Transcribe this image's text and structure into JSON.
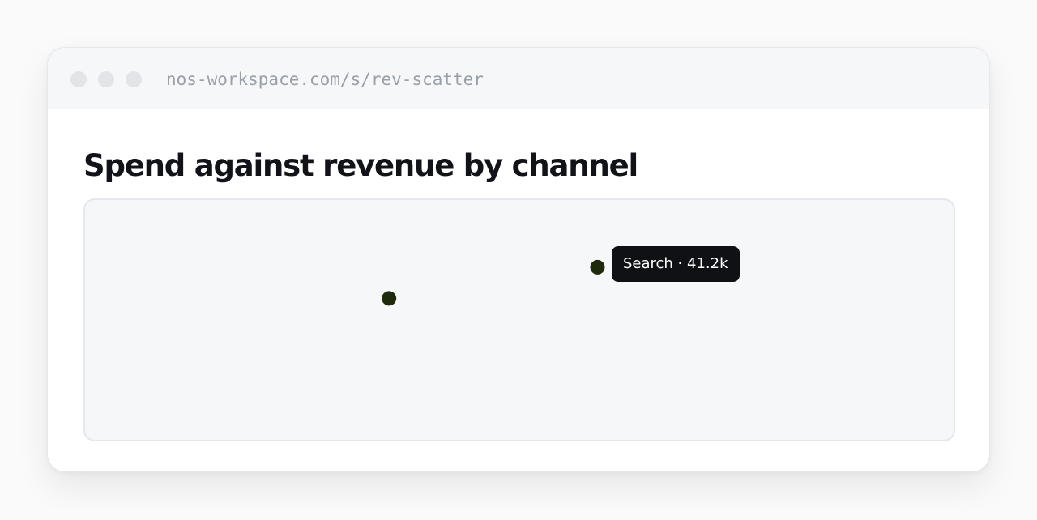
{
  "browser": {
    "url": "nos-workspace.com/s/rev-scatter"
  },
  "page": {
    "title": "Spend against revenue by channel"
  },
  "chart_data": {
    "type": "scatter",
    "points": [
      {
        "label": "",
        "x": 0.35,
        "y": 0.59
      },
      {
        "label": "Search",
        "x": 0.59,
        "y": 0.72
      }
    ],
    "tooltip": {
      "text": "Search · 41.2k",
      "target_index": 1
    },
    "point_color": "#1f2a0a",
    "grid": false,
    "axes_visible": false
  }
}
